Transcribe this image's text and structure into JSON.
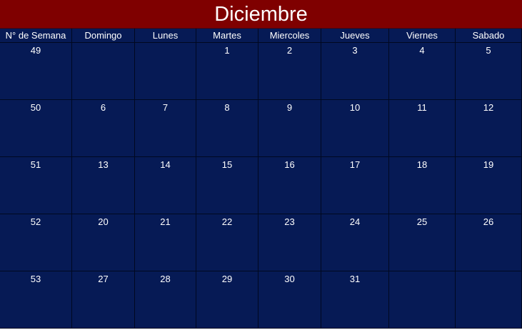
{
  "title": "Diciembre",
  "headers": [
    "N° de Semana",
    "Domingo",
    "Lunes",
    "Martes",
    "Miercoles",
    "Jueves",
    "Viernes",
    "Sabado"
  ],
  "rows": [
    [
      "49",
      "",
      "",
      "1",
      "2",
      "3",
      "4",
      "5"
    ],
    [
      "50",
      "6",
      "7",
      "8",
      "9",
      "10",
      "11",
      "12"
    ],
    [
      "51",
      "13",
      "14",
      "15",
      "16",
      "17",
      "18",
      "19"
    ],
    [
      "52",
      "20",
      "21",
      "22",
      "23",
      "24",
      "25",
      "26"
    ],
    [
      "53",
      "27",
      "28",
      "29",
      "30",
      "31",
      "",
      ""
    ]
  ],
  "colors": {
    "title_bg": "#7f0000",
    "grid_bg": "#061a55",
    "text": "#ffffff"
  }
}
